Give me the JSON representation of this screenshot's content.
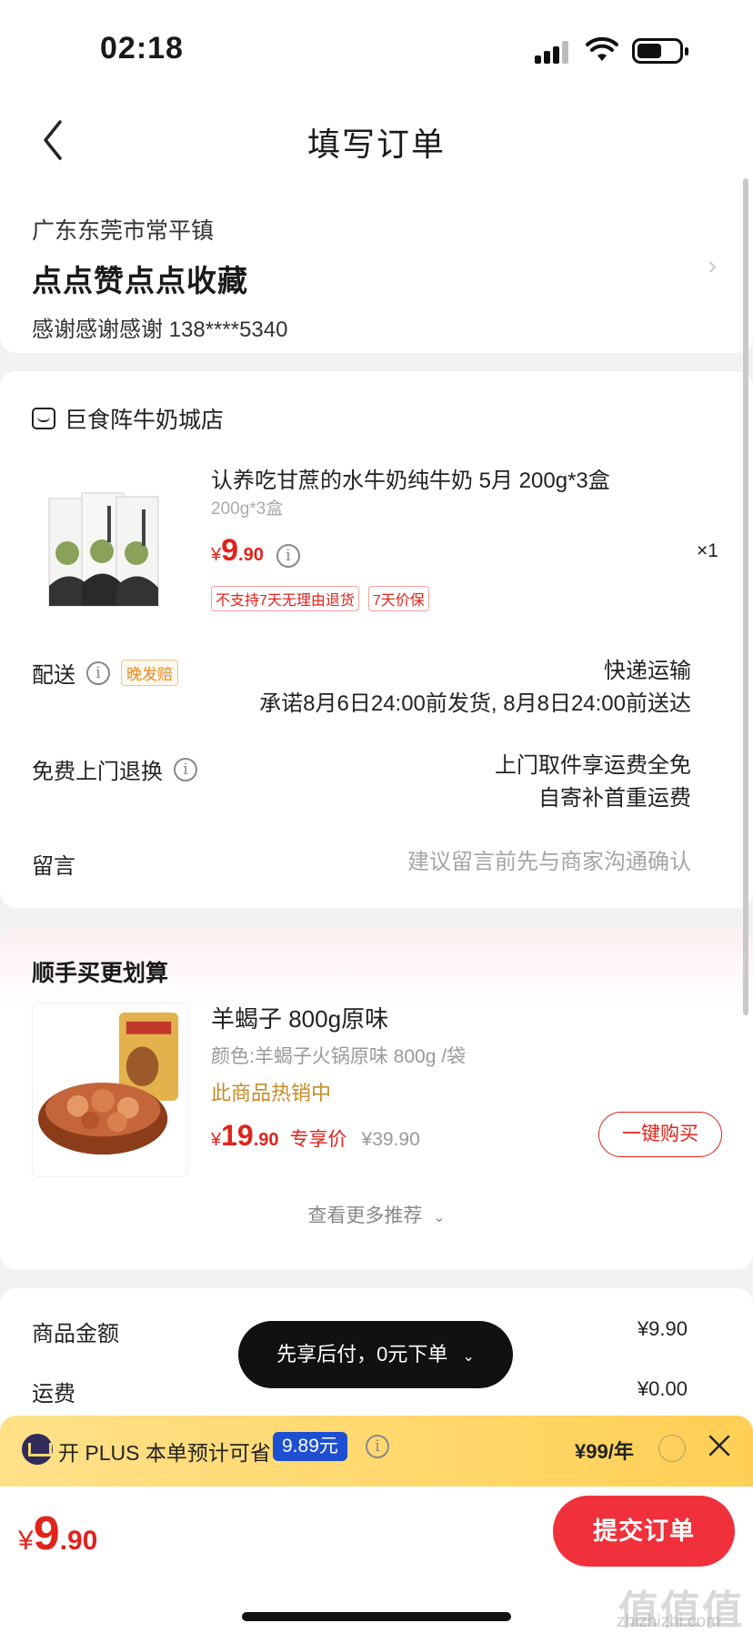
{
  "status_bar": {
    "time": "02:18"
  },
  "header": {
    "title": "填写订单"
  },
  "address": {
    "region": "广东东莞市常平镇",
    "name": "点点赞点点收藏",
    "contact": "感谢感谢感谢  138****5340",
    "chevron": "›"
  },
  "order": {
    "shop_name": "巨食阵牛奶城店",
    "product": {
      "title": "认养吃甘蔗的水牛奶纯牛奶 5月 200g*3盒",
      "spec": "200g*3盒",
      "price_yen": "¥",
      "price_int": "9",
      "price_dec": ".90",
      "qty": "×1",
      "tags": [
        "不支持7天无理由退货",
        "7天价保"
      ],
      "info_glyph": "i"
    },
    "delivery": {
      "label": "配送",
      "late_tag": "晚发赔",
      "method": "快递运输",
      "promise": "承诺8月6日24:00前发货, 8月8日24:00前送达"
    },
    "return": {
      "label": "免费上门退换",
      "line1": "上门取件享运费全免",
      "line2": "自寄补首重运费"
    },
    "message": {
      "label": "留言",
      "placeholder": "建议留言前先与商家沟通确认"
    }
  },
  "upsell": {
    "heading": "顺手买更划算",
    "title": "羊蝎子 800g原味",
    "color": "颜色:羊蝎子火锅原味 800g /袋",
    "hot": "此商品热销中",
    "price_yen": "¥",
    "price_int": "19",
    "price_dec": ".90",
    "vip_label": "专享价",
    "orig_price": "¥39.90",
    "buy_button": "一键购买",
    "more": "查看更多推荐"
  },
  "summary": {
    "goods_label": "商品金额",
    "goods_value": "¥9.90",
    "freight_label": "运费",
    "freight_value": "¥0.00"
  },
  "float_pill": {
    "label": "先享后付，0元下单",
    "chevron": "⌄"
  },
  "plus_bar": {
    "text": "开 PLUS 本单预计可省",
    "amount": "9.89元",
    "price": "¥99/年",
    "close": "✕"
  },
  "bottom": {
    "total_yen": "¥",
    "total_int": "9",
    "total_dec": ".90",
    "submit": "提交订单",
    "watermark": "值值值",
    "watermark_url": "zhizhizhi.com"
  },
  "colors": {
    "accent_red": "#e0231b",
    "submit_red": "#f0303a",
    "plus_gold": "#ffd76a",
    "plus_blue": "#1f4fd1"
  },
  "icons": [
    "back-chevron-icon",
    "shop-icon",
    "info-icon",
    "crown-icon",
    "close-icon",
    "signal-icon",
    "wifi-icon",
    "battery-icon"
  ]
}
